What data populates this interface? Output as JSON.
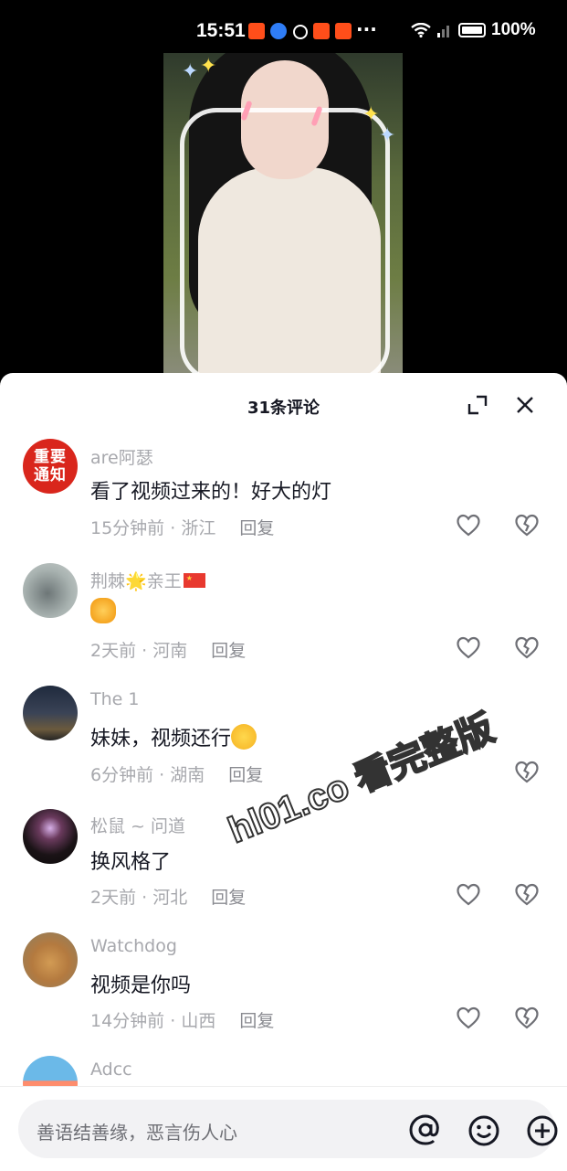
{
  "status_bar": {
    "time": "15:51",
    "more": "···",
    "battery": "100%"
  },
  "sheet": {
    "title": "31条评论"
  },
  "comments": [
    {
      "avatar_text": "重要\n通知",
      "name": "are阿瑟",
      "text": "看了视频过来的！好大的灯",
      "time": "15分钟前",
      "location": "浙江",
      "reply": "回复"
    },
    {
      "name_prefix": "荆棘",
      "name_star": "🌟",
      "name_suffix": "亲王",
      "text_emoji": "clapping-hands",
      "time": "2天前",
      "location": "河南",
      "reply": "回复"
    },
    {
      "name": "The 1",
      "text": "妹妹，视频还行",
      "text_emoji": "rolling-laughing",
      "time": "6分钟前",
      "location": "湖南",
      "reply": "回复"
    },
    {
      "name": "松鼠 ~ 问道",
      "text": "换风格了",
      "time": "2天前",
      "location": "河北",
      "reply": "回复"
    },
    {
      "name": "Watchdog",
      "text": "视频是你吗",
      "time": "14分钟前",
      "location": "山西",
      "reply": "回复"
    },
    {
      "name": "Adcc"
    }
  ],
  "watermark": "hl01.co 看完整版",
  "input": {
    "placeholder": "善语结善缘，恶言伤人心"
  },
  "colors": {
    "text_primary": "#161823",
    "text_secondary": "#a7a8ad",
    "badge_red": "#d9261c",
    "input_bg": "#f2f2f4"
  }
}
